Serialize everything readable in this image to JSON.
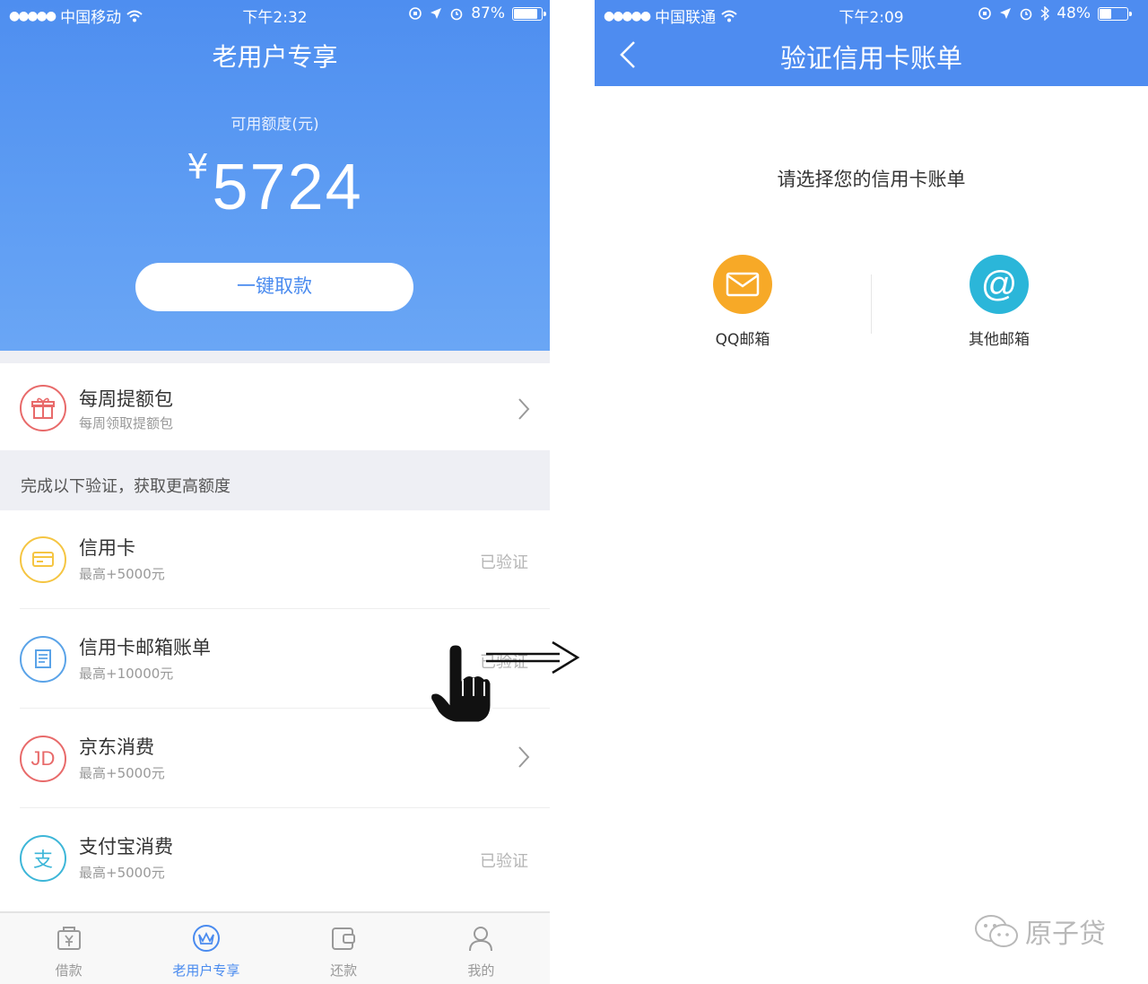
{
  "left": {
    "status": {
      "carrier": "中国移动",
      "time": "下午2:32",
      "battery": "87%",
      "battery_level": 0.87
    },
    "header": {
      "title": "老用户专享",
      "credit_label": "可用额度(元)",
      "currency": "¥",
      "amount": "5724",
      "withdraw_button": "一键取款"
    },
    "weekly": {
      "title": "每周提额包",
      "subtitle": "每周领取提额包"
    },
    "section_label": "完成以下验证，获取更高额度",
    "items": [
      {
        "title": "信用卡",
        "subtitle": "最高+5000元",
        "status": "已验证",
        "icon": "card-icon",
        "color": "#f5c542"
      },
      {
        "title": "信用卡邮箱账单",
        "subtitle": "最高+10000元",
        "status": "已验证",
        "icon": "bill-icon",
        "color": "#5aa3e8"
      },
      {
        "title": "京东消费",
        "subtitle": "最高+5000元",
        "status": "",
        "icon": "jd-icon",
        "icon_text": "JD",
        "color": "#e86a6a"
      },
      {
        "title": "支付宝消费",
        "subtitle": "最高+5000元",
        "status": "已验证",
        "icon": "alipay-icon",
        "icon_text": "支",
        "color": "#3db6d8"
      }
    ],
    "tabs": [
      {
        "label": "借款",
        "icon": "loan-icon"
      },
      {
        "label": "老用户专享",
        "icon": "crown-icon",
        "active": true
      },
      {
        "label": "还款",
        "icon": "repay-icon"
      },
      {
        "label": "我的",
        "icon": "user-icon"
      }
    ]
  },
  "right": {
    "status": {
      "carrier": "中国联通",
      "time": "下午2:09",
      "battery": "48%",
      "battery_level": 0.48
    },
    "title": "验证信用卡账单",
    "prompt": "请选择您的信用卡账单",
    "options": [
      {
        "label": "QQ邮箱",
        "icon": "envelope-icon",
        "color": "#f7a927"
      },
      {
        "label": "其他邮箱",
        "icon": "at-icon",
        "icon_text": "@",
        "color": "#2bb6d9"
      }
    ]
  },
  "watermark": "原子贷",
  "colors": {
    "primary_blue": "#4e8cf0",
    "muted": "#999999"
  }
}
